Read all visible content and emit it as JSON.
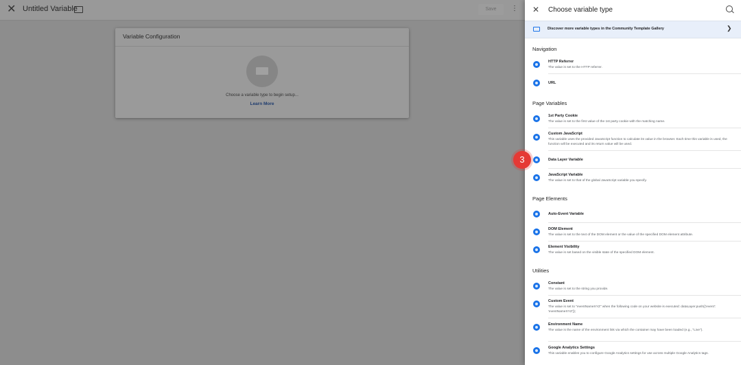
{
  "editor": {
    "title": "Untitled Variable",
    "save_label": "Save",
    "card_title": "Variable Configuration",
    "card_hint": "Choose a variable type to begin setup...",
    "card_link": "Learn More"
  },
  "panel": {
    "title": "Choose variable type",
    "banner": "Discover more variable types in the Community Template Gallery"
  },
  "sections": {
    "navigation": "Navigation",
    "page_variables": "Page Variables",
    "page_elements": "Page Elements",
    "utilities": "Utilities"
  },
  "items": {
    "http_referrer": {
      "name": "HTTP Referrer",
      "desc": "The value is set to the HTTP referrer."
    },
    "url": {
      "name": "URL"
    },
    "first_party_cookie": {
      "name": "1st Party Cookie",
      "desc": "The value is set to the first value of the 1st party cookie with the matching name."
    },
    "custom_js": {
      "name": "Custom JavaScript",
      "desc": "This variable uses the provided JavaScript function to calculate its value in the browser. Each time this variable is used, the function will be executed and its return value will be used."
    },
    "data_layer": {
      "name": "Data Layer Variable"
    },
    "js_variable": {
      "name": "JavaScript Variable",
      "desc": "The value is set to that of the global JavaScript variable you specify."
    },
    "auto_event": {
      "name": "Auto-Event Variable"
    },
    "dom_element": {
      "name": "DOM Element",
      "desc": "The value is set to the text of the DOM element or the value of the specified DOM element attribute."
    },
    "element_visibility": {
      "name": "Element Visibility",
      "desc": "The value is set based on the visible state of the specified DOM element."
    },
    "constant": {
      "name": "Constant",
      "desc": "The value is set to the string you provide."
    },
    "custom_event": {
      "name": "Custom Event",
      "desc": "The value is set to \"eventNameXYZ\" when the following code on your website is executed: dataLayer.push({'event': 'eventNameXYZ'});"
    },
    "environment_name": {
      "name": "Environment Name",
      "desc": "The value is the name of the environment link via which the container may have been loaded (e.g., \"Live\")."
    },
    "ga_settings": {
      "name": "Google Analytics Settings",
      "desc": "This variable enables you to configure Google Analytics settings for use across multiple Google Analytics tags."
    }
  },
  "step_badge": "3",
  "colors": {
    "accent": "#1a73e8",
    "badge": "#e53935",
    "banner": "#e8effa"
  }
}
